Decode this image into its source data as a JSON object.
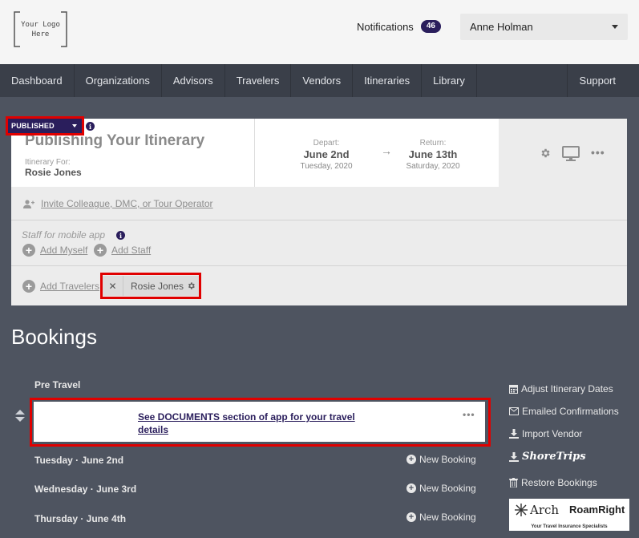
{
  "header": {
    "logo_text": "Your Logo Here",
    "notifications_label": "Notifications",
    "notifications_count": "46",
    "user_name": "Anne Holman"
  },
  "nav": {
    "items": [
      "Dashboard",
      "Organizations",
      "Advisors",
      "Travelers",
      "Vendors",
      "Itineraries",
      "Library"
    ],
    "support": "Support"
  },
  "itinerary": {
    "status": "PUBLISHED",
    "title": "Publishing Your Itinerary",
    "for_label": "Itinerary For:",
    "for_name": "Rosie Jones",
    "depart_label": "Depart:",
    "depart_date": "June 2nd",
    "depart_sub": "Tuesday, 2020",
    "return_label": "Return:",
    "return_date": "June 13th",
    "return_sub": "Saturday, 2020",
    "arrow": "→"
  },
  "invite": {
    "label": "Invite Colleague, DMC, or Tour Operator"
  },
  "staff": {
    "label": "Staff for mobile app",
    "add_myself": "Add Myself",
    "add_staff": "Add Staff"
  },
  "travelers": {
    "add_label": "Add Travelers",
    "chip_remove": "✕",
    "chip_name": "Rosie Jones"
  },
  "bookings": {
    "title": "Bookings",
    "pre_travel": "Pre Travel",
    "card_link": "See DOCUMENTS section of app for your travel details",
    "days": [
      {
        "label": "Tuesday · June 2nd",
        "action": "New Booking"
      },
      {
        "label": "Wednesday · June 3rd",
        "action": "New Booking"
      },
      {
        "label": "Thursday · June 4th",
        "action": "New Booking"
      }
    ]
  },
  "side_actions": {
    "adjust_dates": "Adjust Itinerary Dates",
    "emailed_confirmations": "Emailed Confirmations",
    "import_vendor": "Import Vendor",
    "shoretrips": "ShoreTrips",
    "restore_bookings": "Restore Bookings"
  },
  "partner": {
    "arch": "Arch",
    "roam": "RoamRight",
    "tagline": "Your Travel Insurance Specialists"
  },
  "colors": {
    "accent": "#2a1e5c",
    "highlight": "#e00000",
    "background": "#4e5460",
    "nav": "#3a3f49"
  },
  "icons": [
    "gear-icon",
    "monitor-icon",
    "more-icon",
    "info-icon",
    "add-user-icon",
    "plus-circle-icon",
    "reorder-icon",
    "calendar-icon",
    "envelope-icon",
    "download-icon",
    "trash-icon",
    "caret-down-icon",
    "close-icon"
  ]
}
